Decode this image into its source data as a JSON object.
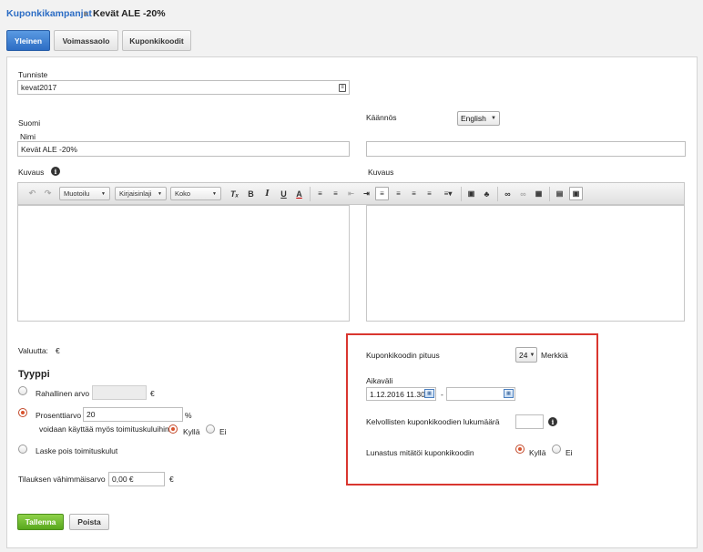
{
  "breadcrumb": {
    "parent": "Kuponkikampanjat",
    "current": "Kevät ALE -20%"
  },
  "tabs": [
    {
      "label": "Yleinen",
      "active": true
    },
    {
      "label": "Voimassaolo",
      "active": false
    },
    {
      "label": "Kuponkikoodit",
      "active": false
    }
  ],
  "form": {
    "id_label": "Tunniste",
    "id_value": "kevat2017",
    "language_label": "Suomi",
    "translation_label": "Käännös",
    "translation_lang": "English",
    "name_label": "Nimi",
    "name_value": "Kevät ALE -20%",
    "translation_name_value": "",
    "description_label": "Kuvaus",
    "translation_description_label": "Kuvaus"
  },
  "toolbar": {
    "format_select": "Muotoilu",
    "font_select": "Kirjaisinlaji",
    "size_select": "Koko"
  },
  "left": {
    "currency_label": "Valuutta:",
    "currency_value": "€",
    "type_heading": "Tyyppi",
    "monetary_label": "Rahallinen arvo",
    "monetary_unit": "€",
    "percent_label": "Prosenttiarvo",
    "percent_value": "20",
    "percent_unit": "%",
    "shipping_question": "voidaan käyttää myös toimituskuluihin",
    "yes_label": "Kyllä",
    "no_label": "Ei",
    "shipping_deduct_label": "Laske pois toimituskulut",
    "min_order_label": "Tilauksen vähimmäisarvo",
    "min_order_value": "0,00 €",
    "min_order_unit": "€"
  },
  "right": {
    "code_length_label": "Kuponkikoodin pituus",
    "code_length_value": "24",
    "chars_label": "Merkkiä",
    "period_label": "Aikaväli",
    "period_start": "1.12.2016 11.30",
    "period_dash": "-",
    "period_end": "",
    "valid_count_label": "Kelvollisten kuponkikoodien lukumäärä",
    "valid_count_value": "",
    "redeem_label": "Lunastus mitätöi kuponkikoodin",
    "yes_label": "Kyllä",
    "no_label": "Ei"
  },
  "actions": {
    "save": "Tallenna",
    "delete": "Poista"
  },
  "colors": {
    "accent": "#2b6cc4",
    "save_green": "#58a81d",
    "highlight_red": "#d9362f",
    "radio_on": "#d9532d"
  }
}
